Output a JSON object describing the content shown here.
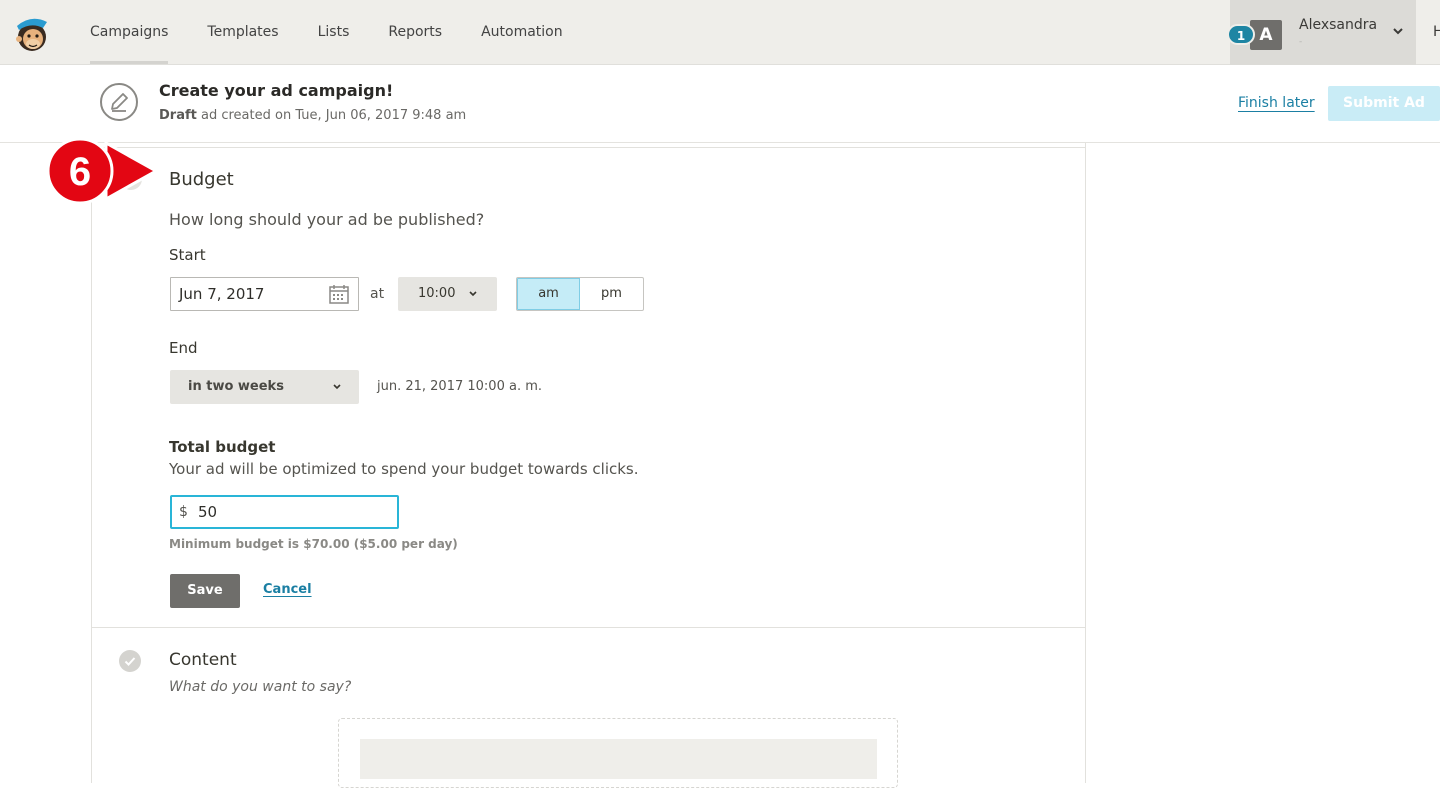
{
  "nav": {
    "links": [
      "Campaigns",
      "Templates",
      "Lists",
      "Reports",
      "Automation"
    ],
    "notif_count": "1",
    "avatar_letter": "A",
    "username": "Alexsandra",
    "userstatus": "-",
    "help_trunc": "H"
  },
  "header": {
    "title": "Create your ad campaign!",
    "draft_word": "Draft",
    "subtitle_rest": " ad created on Tue, Jun 06, 2017 9:48 am",
    "finish_later": "Finish later",
    "submit": "Submit Ad"
  },
  "callout": {
    "number": "6"
  },
  "budget_section": {
    "title": "Budget",
    "question": "How long should your ad be published?",
    "start_label": "Start",
    "start_date": "Jun 7, 2017",
    "at": "at",
    "time": "10:00",
    "am": "am",
    "pm": "pm",
    "selected_meridiem": "am",
    "end_label": "End",
    "end_option": "in two weeks",
    "end_date": "jun. 21, 2017 10:00 a. m.",
    "total_label": "Total budget",
    "total_sub": "Your ad will be optimized to spend your budget towards clicks.",
    "currency": "$",
    "amount": "50",
    "min_note": "Minimum budget is $70.00 ($5.00 per day)",
    "save": "Save",
    "cancel": "Cancel"
  },
  "content_section": {
    "title": "Content",
    "subtitle": "What do you want to say?"
  },
  "colors": {
    "accent": "#29b5d7",
    "link": "#1b7fa3",
    "callout_red": "#e30613"
  }
}
